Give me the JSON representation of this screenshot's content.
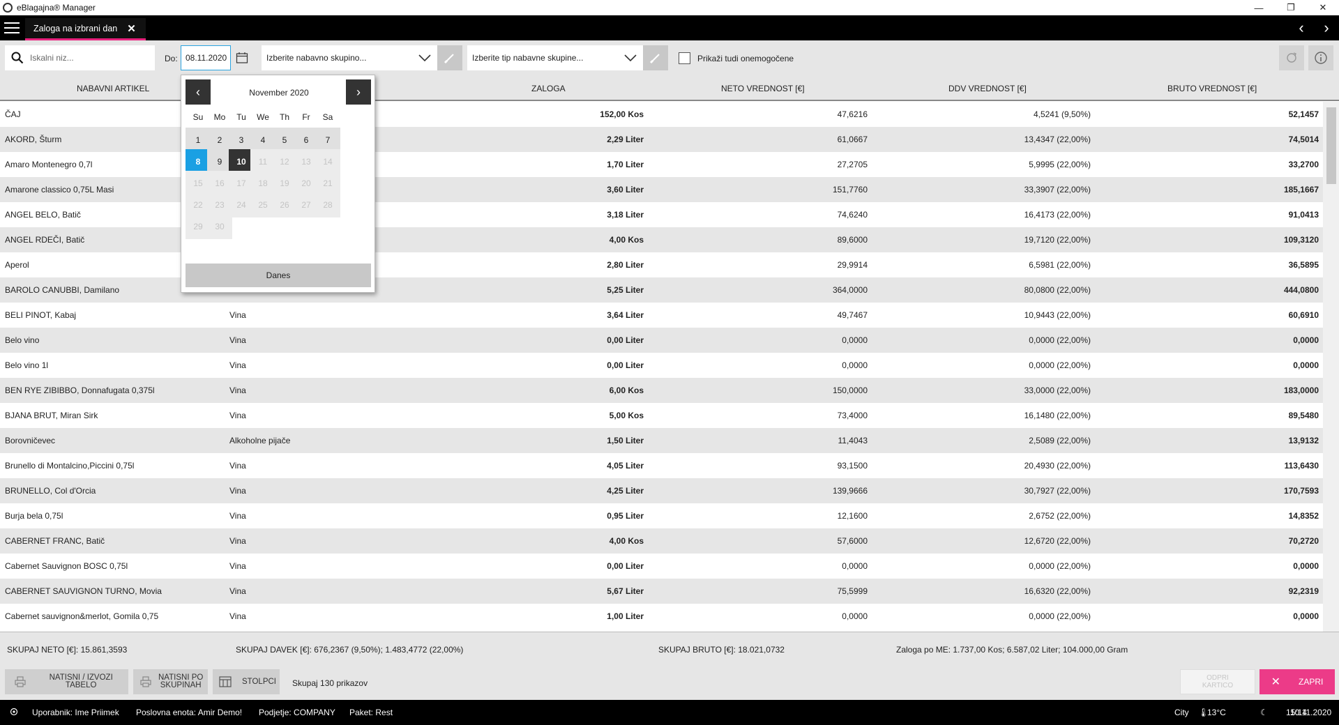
{
  "app": {
    "title": "eBlagajna® Manager"
  },
  "window": {
    "minimize": "—",
    "restore": "❐",
    "close": "✕"
  },
  "tab": {
    "label": "Zaloga na izbrani dan",
    "close": "✕"
  },
  "nav": {
    "back": "‹",
    "forward": "›"
  },
  "toolbar": {
    "search_placeholder": "Iskalni niz...",
    "date_label": "Do:",
    "date_value": "08.11.2020",
    "group_select": "Izberite nabavno skupino...",
    "type_select": "Izberite tip nabavne skupine...",
    "show_disabled_label": "Prikaži tudi onemogočene"
  },
  "columns": {
    "article": "NABAVNI ARTIKEL",
    "stock": "ZALOGA",
    "neto": "NETO VREDNOST [€]",
    "ddv": "DDV VREDNOST [€]",
    "bruto": "BRUTO VREDNOST [€]"
  },
  "rows": [
    {
      "name": "ČAJ",
      "group": "",
      "qty": "152,00 Kos",
      "neto": "47,6216",
      "ddv": "4,5241 (9,50%)",
      "bruto": "52,1457"
    },
    {
      "name": "AKORD, Šturm",
      "group": "",
      "qty": "2,29 Liter",
      "neto": "61,0667",
      "ddv": "13,4347 (22,00%)",
      "bruto": "74,5014"
    },
    {
      "name": "Amaro Montenegro 0,7l",
      "group": "",
      "qty": "1,70 Liter",
      "neto": "27,2705",
      "ddv": "5,9995 (22,00%)",
      "bruto": "33,2700"
    },
    {
      "name": "Amarone classico 0,75L Masi",
      "group": "",
      "qty": "3,60 Liter",
      "neto": "151,7760",
      "ddv": "33,3907 (22,00%)",
      "bruto": "185,1667"
    },
    {
      "name": "ANGEL BELO, Batič",
      "group": "",
      "qty": "3,18 Liter",
      "neto": "74,6240",
      "ddv": "16,4173 (22,00%)",
      "bruto": "91,0413"
    },
    {
      "name": "ANGEL RDEČI, Batič",
      "group": "",
      "qty": "4,00 Kos",
      "neto": "89,6000",
      "ddv": "19,7120 (22,00%)",
      "bruto": "109,3120"
    },
    {
      "name": "Aperol",
      "group": "",
      "qty": "2,80 Liter",
      "neto": "29,9914",
      "ddv": "6,5981 (22,00%)",
      "bruto": "36,5895"
    },
    {
      "name": "BAROLO CANUBBI, Damilano",
      "group": "",
      "qty": "5,25 Liter",
      "neto": "364,0000",
      "ddv": "80,0800 (22,00%)",
      "bruto": "444,0800"
    },
    {
      "name": "BELI PINOT, Kabaj",
      "group": "Vina",
      "qty": "3,64 Liter",
      "neto": "49,7467",
      "ddv": "10,9443 (22,00%)",
      "bruto": "60,6910"
    },
    {
      "name": "Belo vino",
      "group": "Vina",
      "qty": "0,00 Liter",
      "neto": "0,0000",
      "ddv": "0,0000 (22,00%)",
      "bruto": "0,0000"
    },
    {
      "name": "Belo vino 1l",
      "group": "Vina",
      "qty": "0,00 Liter",
      "neto": "0,0000",
      "ddv": "0,0000 (22,00%)",
      "bruto": "0,0000"
    },
    {
      "name": "BEN RYE ZIBIBBO, Donnafugata 0,375l",
      "group": "Vina",
      "qty": "6,00 Kos",
      "neto": "150,0000",
      "ddv": "33,0000 (22,00%)",
      "bruto": "183,0000"
    },
    {
      "name": "BJANA BRUT, Miran Sirk",
      "group": "Vina",
      "qty": "5,00 Kos",
      "neto": "73,4000",
      "ddv": "16,1480 (22,00%)",
      "bruto": "89,5480"
    },
    {
      "name": "Borovničevec",
      "group": "Alkoholne pijače",
      "qty": "1,50 Liter",
      "neto": "11,4043",
      "ddv": "2,5089 (22,00%)",
      "bruto": "13,9132"
    },
    {
      "name": "Brunello di Montalcino,Piccini 0,75l",
      "group": "Vina",
      "qty": "4,05 Liter",
      "neto": "93,1500",
      "ddv": "20,4930 (22,00%)",
      "bruto": "113,6430"
    },
    {
      "name": "BRUNELLO, Col d'Orcia",
      "group": "Vina",
      "qty": "4,25 Liter",
      "neto": "139,9666",
      "ddv": "30,7927 (22,00%)",
      "bruto": "170,7593"
    },
    {
      "name": "Burja bela 0,75l",
      "group": "Vina",
      "qty": "0,95 Liter",
      "neto": "12,1600",
      "ddv": "2,6752 (22,00%)",
      "bruto": "14,8352"
    },
    {
      "name": "CABERNET FRANC, Batič",
      "group": "Vina",
      "qty": "4,00 Kos",
      "neto": "57,6000",
      "ddv": "12,6720 (22,00%)",
      "bruto": "70,2720"
    },
    {
      "name": "Cabernet Sauvignon BOSC 0,75l",
      "group": "Vina",
      "qty": "0,00 Liter",
      "neto": "0,0000",
      "ddv": "0,0000 (22,00%)",
      "bruto": "0,0000"
    },
    {
      "name": "CABERNET SAUVIGNON TURNO, Movia",
      "group": "Vina",
      "qty": "5,67 Liter",
      "neto": "75,5999",
      "ddv": "16,6320 (22,00%)",
      "bruto": "92,2319"
    },
    {
      "name": "Cabernet sauvignon&merlot, Gomila 0,75",
      "group": "Vina",
      "qty": "1,00 Liter",
      "neto": "0,0000",
      "ddv": "0,0000 (22,00%)",
      "bruto": "0,0000"
    }
  ],
  "calendar": {
    "month_label": "November 2020",
    "prev": "‹",
    "next": "›",
    "weekdays": [
      "Su",
      "Mo",
      "Tu",
      "We",
      "Th",
      "Fr",
      "Sa"
    ],
    "days": [
      {
        "d": "1",
        "state": "normal"
      },
      {
        "d": "2",
        "state": "normal"
      },
      {
        "d": "3",
        "state": "normal"
      },
      {
        "d": "4",
        "state": "normal"
      },
      {
        "d": "5",
        "state": "normal"
      },
      {
        "d": "6",
        "state": "normal"
      },
      {
        "d": "7",
        "state": "normal"
      },
      {
        "d": "8",
        "state": "selected"
      },
      {
        "d": "9",
        "state": "normal"
      },
      {
        "d": "10",
        "state": "today"
      },
      {
        "d": "11",
        "state": "disabled"
      },
      {
        "d": "12",
        "state": "disabled"
      },
      {
        "d": "13",
        "state": "disabled"
      },
      {
        "d": "14",
        "state": "disabled"
      },
      {
        "d": "15",
        "state": "disabled"
      },
      {
        "d": "16",
        "state": "disabled"
      },
      {
        "d": "17",
        "state": "disabled"
      },
      {
        "d": "18",
        "state": "disabled"
      },
      {
        "d": "19",
        "state": "disabled"
      },
      {
        "d": "20",
        "state": "disabled"
      },
      {
        "d": "21",
        "state": "disabled"
      },
      {
        "d": "22",
        "state": "disabled"
      },
      {
        "d": "23",
        "state": "disabled"
      },
      {
        "d": "24",
        "state": "disabled"
      },
      {
        "d": "25",
        "state": "disabled"
      },
      {
        "d": "26",
        "state": "disabled"
      },
      {
        "d": "27",
        "state": "disabled"
      },
      {
        "d": "28",
        "state": "disabled"
      },
      {
        "d": "29",
        "state": "disabled"
      },
      {
        "d": "30",
        "state": "disabled"
      }
    ],
    "today_button": "Danes"
  },
  "summary": {
    "neto": "SKUPAJ NETO [€]: 15.861,3593",
    "davek": "SKUPAJ DAVEK [€]: 676,2367 (9,50%); 1.483,4772 (22,00%)",
    "bruto": "SKUPAJ BRUTO [€]: 18.021,0732",
    "zaloga": "Zaloga po ME: 1.737,00 Kos; 6.587,02 Liter; 104.000,00 Gram"
  },
  "actions": {
    "print_export": "NATISNI / IZVOZI TABELO",
    "print_groups_1": "NATISNI PO",
    "print_groups_2": "SKUPINAH",
    "columns": "STOLPCI",
    "count": "Skupaj 130 prikazov",
    "open_card_1": "ODPRI",
    "open_card_2": "KARTICO",
    "close": "ZAPRI"
  },
  "status": {
    "user": "Uporabnik: Ime Priimek",
    "unit": "Poslovna enota: Amir Demo!",
    "company": "Podjetje: COMPANY",
    "package": "Paket: Rest",
    "city": "City",
    "temp": "13°C",
    "time": "15:14",
    "date": "10.11.2020"
  },
  "colors": {
    "accent": "#e9217d",
    "selected_day": "#1aa0e3",
    "close_button": "#ec3b88"
  }
}
